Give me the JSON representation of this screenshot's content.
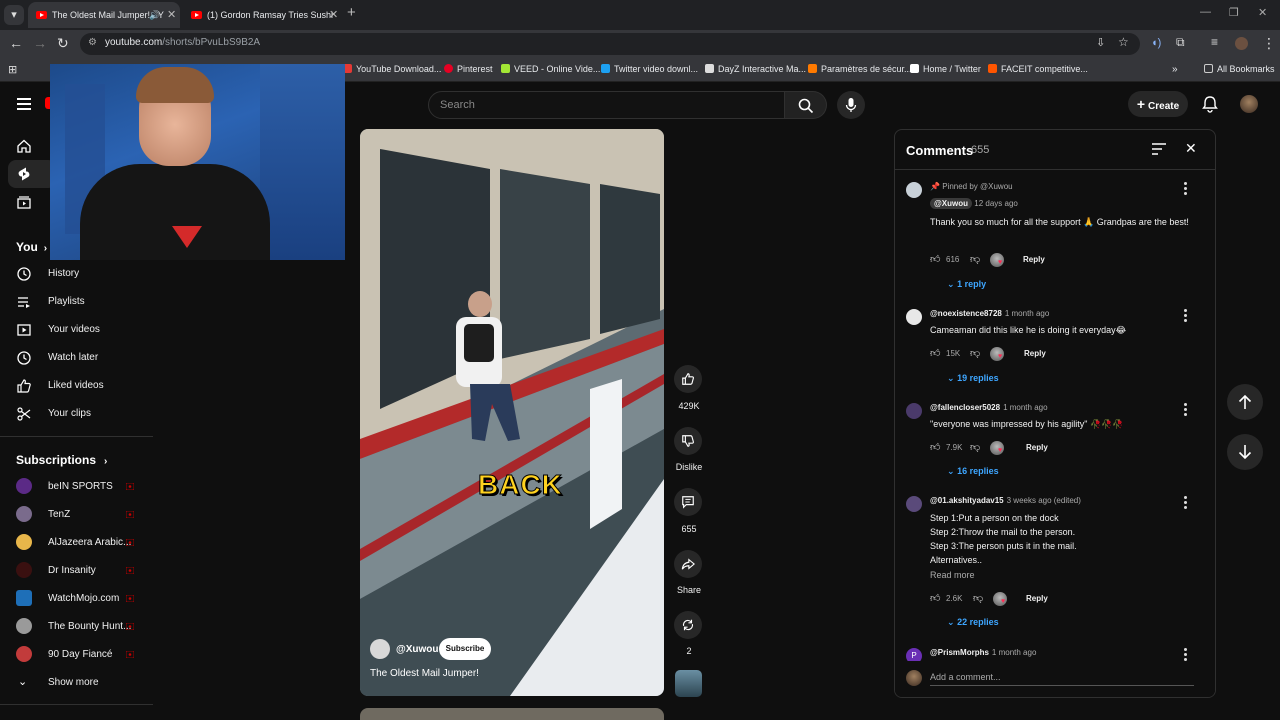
{
  "browser": {
    "tabs": [
      {
        "title": "The Oldest Mail Jumper! - Y",
        "active": true
      },
      {
        "title": "(1) Gordon Ramsay Tries Sushi",
        "active": false
      }
    ],
    "url_host": "youtube.com",
    "url_path": "/shorts/bPvuLbS9B2A",
    "bookmarks": [
      "YouTube Download...",
      "Pinterest",
      "VEED - Online Vide...",
      "Twitter video downl...",
      "DayZ Interactive Ma...",
      "Paramètres de sécur...",
      "Home / Twitter",
      "FACEIT competitive..."
    ],
    "all_bookmarks": "All Bookmarks"
  },
  "header": {
    "search_placeholder": "Search",
    "create_label": "Create"
  },
  "sidebar": {
    "you_label": "You",
    "you_items": [
      "History",
      "Playlists",
      "Your videos",
      "Watch later",
      "Liked videos",
      "Your clips"
    ],
    "subscriptions_label": "Subscriptions",
    "subscriptions": [
      "beIN SPORTS",
      "TenZ",
      "AlJazeera Arabic...",
      "Dr Insanity",
      "WatchMojo.com",
      "The Bounty Hunt...",
      "90 Day Fiancé"
    ],
    "show_more": "Show more"
  },
  "short": {
    "caption_overlay": "BACK",
    "channel": "@Xuwou",
    "subscribe_label": "Subscribe",
    "title": "The Oldest Mail Jumper!",
    "likes": "429K",
    "dislike_label": "Dislike",
    "comments_count": "655",
    "share_label": "Share",
    "remix_count": "2"
  },
  "comments": {
    "title": "Comments",
    "count": "655",
    "items": [
      {
        "pinned": "Pinned by @Xuwou",
        "author": "@Xuwou",
        "time": "12 days ago",
        "text": "Thank you so much for all the support 🙏 Grandpas are the best!",
        "likes": "616",
        "replies": "1 reply"
      },
      {
        "author": "@noexistence8728",
        "time": "1 month ago",
        "text": "Cameaman did this like he is doing it everyday😂",
        "likes": "15K",
        "replies": "19 replies"
      },
      {
        "author": "@fallencloser5028",
        "time": "1 month ago",
        "text": "\"everyone was impressed by his agility\" 🥀🥀🥀",
        "likes": "7.9K",
        "replies": "16 replies"
      },
      {
        "author": "@01.akshityadav15",
        "time": "3 weeks ago (edited)",
        "text_lines": [
          "Step 1:Put a person on the dock",
          "Step 2:Throw the mail to the person.",
          "Step 3:The person puts it in the mail.",
          "Alternatives.."
        ],
        "read_more": "Read more",
        "likes": "2.6K",
        "replies": "22 replies"
      },
      {
        "author": "@PrismMorphs",
        "time": "1 month ago",
        "avatar_letter": "P"
      }
    ],
    "reply_label": "Reply",
    "add_placeholder": "Add a comment..."
  },
  "colors": {
    "accent": "#3ea6ff",
    "brand": "#ff0000",
    "bg": "#0f0f0f"
  }
}
